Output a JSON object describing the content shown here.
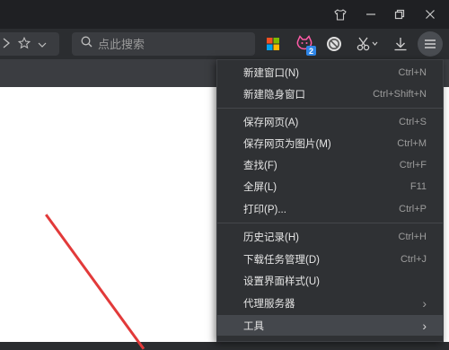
{
  "search": {
    "placeholder": "点此搜索"
  },
  "extensions": {
    "pet_badge": "2"
  },
  "menu": {
    "groups": [
      [
        {
          "label": "新建窗口(N)",
          "shortcut": "Ctrl+N"
        },
        {
          "label": "新建隐身窗口",
          "shortcut": "Ctrl+Shift+N"
        }
      ],
      [
        {
          "label": "保存网页(A)",
          "shortcut": "Ctrl+S"
        },
        {
          "label": "保存网页为图片(M)",
          "shortcut": "Ctrl+M"
        },
        {
          "label": "查找(F)",
          "shortcut": "Ctrl+F"
        },
        {
          "label": "全屏(L)",
          "shortcut": "F11"
        },
        {
          "label": "打印(P)...",
          "shortcut": "Ctrl+P"
        }
      ],
      [
        {
          "label": "历史记录(H)",
          "shortcut": "Ctrl+H"
        },
        {
          "label": "下载任务管理(D)",
          "shortcut": "Ctrl+J"
        },
        {
          "label": "设置界面样式(U)",
          "shortcut": ""
        },
        {
          "label": "代理服务器",
          "shortcut": "›"
        },
        {
          "label": "工具",
          "shortcut": "›",
          "highlighted": true
        }
      ]
    ]
  },
  "icons": {
    "window": [
      "skin-icon",
      "minimize-icon",
      "restore-icon",
      "close-icon"
    ],
    "toolbar": [
      "apps-icon",
      "cat-pet-icon",
      "block-icon",
      "cut-icon",
      "download-icon",
      "menu-icon"
    ]
  },
  "colors": {
    "titlebar": "#1f2023",
    "toolbar": "#2b2d30",
    "menu_bg": "#2f3134",
    "menu_highlight": "#44474c",
    "annotation": "#e23a3a"
  }
}
